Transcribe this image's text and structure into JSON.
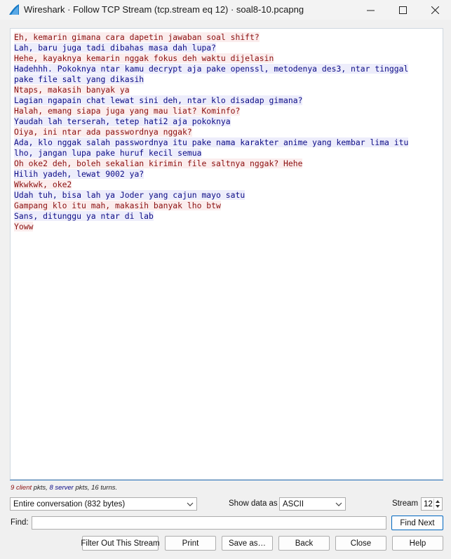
{
  "window": {
    "title": "Wireshark · Follow TCP Stream (tcp.stream eq 12) · soal8-10.pcapng",
    "minimize_glyph": "—",
    "maximize_glyph": "☐",
    "close_glyph": "✕"
  },
  "conversation": [
    {
      "dir": "client",
      "text": "Eh, kemarin gimana cara dapetin jawaban soal shift?"
    },
    {
      "dir": "server",
      "text": "Lah, baru juga tadi dibahas masa dah lupa?"
    },
    {
      "dir": "client",
      "text": "Hehe, kayaknya kemarin nggak fokus deh waktu dijelasin"
    },
    {
      "dir": "server",
      "text": "Hadehhh. Pokoknya ntar kamu decrypt aja pake openssl, metodenya des3, ntar tinggal"
    },
    {
      "dir": "server",
      "text": "pake file salt yang dikasih"
    },
    {
      "dir": "client",
      "text": "Ntaps, makasih banyak ya"
    },
    {
      "dir": "server",
      "text": "Lagian ngapain chat lewat sini deh, ntar klo disadap gimana?"
    },
    {
      "dir": "client",
      "text": "Halah, emang siapa juga yang mau liat? Kominfo?"
    },
    {
      "dir": "server",
      "text": "Yaudah lah terserah, tetep hati2 aja pokoknya"
    },
    {
      "dir": "client",
      "text": "Oiya, ini ntar ada passwordnya nggak?"
    },
    {
      "dir": "server",
      "text": "Ada, klo nggak salah passwordnya itu pake nama karakter anime yang kembar lima itu"
    },
    {
      "dir": "server",
      "text": "lho, jangan lupa pake huruf kecil semua"
    },
    {
      "dir": "client",
      "text": "Oh oke2 deh, boleh sekalian kirimin file saltnya nggak? Hehe"
    },
    {
      "dir": "server",
      "text": "Hilih yadeh, lewat 9002 ya?"
    },
    {
      "dir": "client",
      "text": "Wkwkwk, oke2"
    },
    {
      "dir": "server",
      "text": "Udah tuh, bisa lah ya Joder yang cajun mayo satu"
    },
    {
      "dir": "client",
      "text": "Gampang klo itu mah, makasih banyak lho btw"
    },
    {
      "dir": "server",
      "text": "Sans, ditunggu ya ntar di lab"
    },
    {
      "dir": "client",
      "text": "Yoww"
    }
  ],
  "stats": {
    "client_count": "9",
    "client_word": "client",
    "pkts_sep": " pkts, ",
    "server_count": "8",
    "server_word": "server",
    "tail": " pkts, 16 turns."
  },
  "controls": {
    "conversation_select": "Entire conversation (832 bytes)",
    "show_data_label": "Show data as",
    "show_data_value": "ASCII",
    "stream_label": "Stream",
    "stream_value": "12",
    "find_label": "Find:",
    "find_value": "",
    "find_next": "Find Next"
  },
  "buttons": {
    "filter_out": "Filter Out This Stream",
    "print": "Print",
    "save_as": "Save as…",
    "back": "Back",
    "close": "Close",
    "help": "Help"
  },
  "colors": {
    "client_text": "#8b0e0e",
    "client_bg": "#fbeded",
    "server_text": "#0b0b86",
    "server_bg": "#ededfb"
  }
}
